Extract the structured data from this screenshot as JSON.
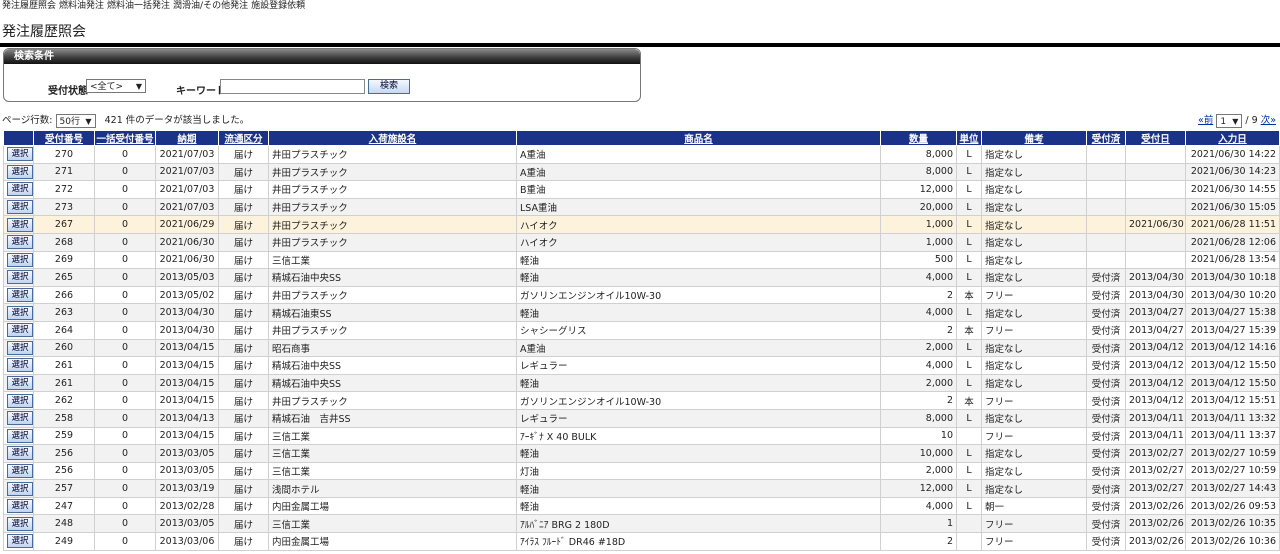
{
  "nav": [
    "発注履歴照会",
    "燃料油発注",
    "燃料油一括発注",
    "潤滑油/その他発注",
    "施設登録依頼"
  ],
  "page_title": "発注履歴照会",
  "search": {
    "header": "検索条件",
    "status_label": "受付状態",
    "status_value": "<全て>",
    "keyword_label": "キーワード",
    "keyword_value": "",
    "button": "検索"
  },
  "pager": {
    "rows_label": "ページ行数:",
    "rows_value": "50行",
    "result_text": "421 件のデータが該当しました。",
    "prev": "«前",
    "page_value": "1",
    "total": "/ 9",
    "next": "次»"
  },
  "table": {
    "select_label": "選択",
    "headers": [
      "",
      "受付番号",
      "一括受付番号",
      "納期",
      "流通区分",
      "入荷施設名",
      "商品名",
      "数量",
      "単位",
      "備考",
      "受付済",
      "受付日",
      "入力日"
    ],
    "rows": [
      [
        "270",
        "0",
        "2021/07/03",
        "届け",
        "井田プラスチック",
        "A重油",
        "8,000",
        "L",
        "指定なし",
        "",
        "",
        "2021/06/30 14:22"
      ],
      [
        "271",
        "0",
        "2021/07/03",
        "届け",
        "井田プラスチック",
        "A重油",
        "8,000",
        "L",
        "指定なし",
        "",
        "",
        "2021/06/30 14:23"
      ],
      [
        "272",
        "0",
        "2021/07/03",
        "届け",
        "井田プラスチック",
        "B重油",
        "12,000",
        "L",
        "指定なし",
        "",
        "",
        "2021/06/30 14:55"
      ],
      [
        "273",
        "0",
        "2021/07/03",
        "届け",
        "井田プラスチック",
        "LSA重油",
        "20,000",
        "L",
        "指定なし",
        "",
        "",
        "2021/06/30 15:05"
      ],
      [
        "267",
        "0",
        "2021/06/29",
        "届け",
        "井田プラスチック",
        "ハイオク",
        "1,000",
        "L",
        "指定なし",
        "",
        "2021/06/30",
        "2021/06/28 11:51"
      ],
      [
        "268",
        "0",
        "2021/06/30",
        "届け",
        "井田プラスチック",
        "ハイオク",
        "1,000",
        "L",
        "指定なし",
        "",
        "",
        "2021/06/28 12:06"
      ],
      [
        "269",
        "0",
        "2021/06/30",
        "届け",
        "三信工業",
        "軽油",
        "500",
        "L",
        "指定なし",
        "",
        "",
        "2021/06/28 13:54"
      ],
      [
        "265",
        "0",
        "2013/05/03",
        "届け",
        "精城石油中央SS",
        "軽油",
        "4,000",
        "L",
        "指定なし",
        "受付済",
        "2013/04/30",
        "2013/04/30 10:18"
      ],
      [
        "266",
        "0",
        "2013/05/02",
        "届け",
        "井田プラスチック",
        "ガソリンエンジンオイル10W-30",
        "2",
        "本",
        "フリー",
        "受付済",
        "2013/04/30",
        "2013/04/30 10:20"
      ],
      [
        "263",
        "0",
        "2013/04/30",
        "届け",
        "精城石油東SS",
        "軽油",
        "4,000",
        "L",
        "指定なし",
        "受付済",
        "2013/04/27",
        "2013/04/27 15:38"
      ],
      [
        "264",
        "0",
        "2013/04/30",
        "届け",
        "井田プラスチック",
        "シャシーグリス",
        "2",
        "本",
        "フリー",
        "受付済",
        "2013/04/27",
        "2013/04/27 15:39"
      ],
      [
        "260",
        "0",
        "2013/04/15",
        "届け",
        "昭石商事",
        "A重油",
        "2,000",
        "L",
        "指定なし",
        "受付済",
        "2013/04/12",
        "2013/04/12 14:16"
      ],
      [
        "261",
        "0",
        "2013/04/15",
        "届け",
        "精城石油中央SS",
        "レギュラー",
        "4,000",
        "L",
        "指定なし",
        "受付済",
        "2013/04/12",
        "2013/04/12 15:50"
      ],
      [
        "261",
        "0",
        "2013/04/15",
        "届け",
        "精城石油中央SS",
        "軽油",
        "2,000",
        "L",
        "指定なし",
        "受付済",
        "2013/04/12",
        "2013/04/12 15:50"
      ],
      [
        "262",
        "0",
        "2013/04/15",
        "届け",
        "井田プラスチック",
        "ガソリンエンジンオイル10W-30",
        "2",
        "本",
        "フリー",
        "受付済",
        "2013/04/12",
        "2013/04/12 15:51"
      ],
      [
        "258",
        "0",
        "2013/04/13",
        "届け",
        "精城石油　吉井SS",
        "レギュラー",
        "8,000",
        "L",
        "指定なし",
        "受付済",
        "2013/04/11",
        "2013/04/11 13:32"
      ],
      [
        "259",
        "0",
        "2013/04/15",
        "届け",
        "三信工業",
        "ｱｰｷﾞﾅ X 40 BULK",
        "10",
        "",
        "フリー",
        "受付済",
        "2013/04/11",
        "2013/04/11 13:37"
      ],
      [
        "256",
        "0",
        "2013/03/05",
        "届け",
        "三信工業",
        "軽油",
        "10,000",
        "L",
        "指定なし",
        "受付済",
        "2013/02/27",
        "2013/02/27 10:59"
      ],
      [
        "256",
        "0",
        "2013/03/05",
        "届け",
        "三信工業",
        "灯油",
        "2,000",
        "L",
        "指定なし",
        "受付済",
        "2013/02/27",
        "2013/02/27 10:59"
      ],
      [
        "257",
        "0",
        "2013/03/19",
        "届け",
        "浅間ホテル",
        "軽油",
        "12,000",
        "L",
        "指定なし",
        "受付済",
        "2013/02/27",
        "2013/02/27 14:43"
      ],
      [
        "247",
        "0",
        "2013/02/28",
        "届け",
        "内田金属工場",
        "軽油",
        "4,000",
        "L",
        "朝一",
        "受付済",
        "2013/02/26",
        "2013/02/26 09:53"
      ],
      [
        "248",
        "0",
        "2013/03/05",
        "届け",
        "三信工業",
        "ｱﾙﾊﾞﾆｱ BRG 2 180D",
        "1",
        "",
        "フリー",
        "受付済",
        "2013/02/26",
        "2013/02/26 10:35"
      ],
      [
        "249",
        "0",
        "2013/03/06",
        "届け",
        "内田金属工場",
        "ｱｲﾗｽ ﾌﾙｰﾄﾞ DR46 #18D",
        "2",
        "",
        "フリー",
        "受付済",
        "2013/02/26",
        "2013/02/26 10:36"
      ]
    ],
    "highlight_row": 4
  }
}
